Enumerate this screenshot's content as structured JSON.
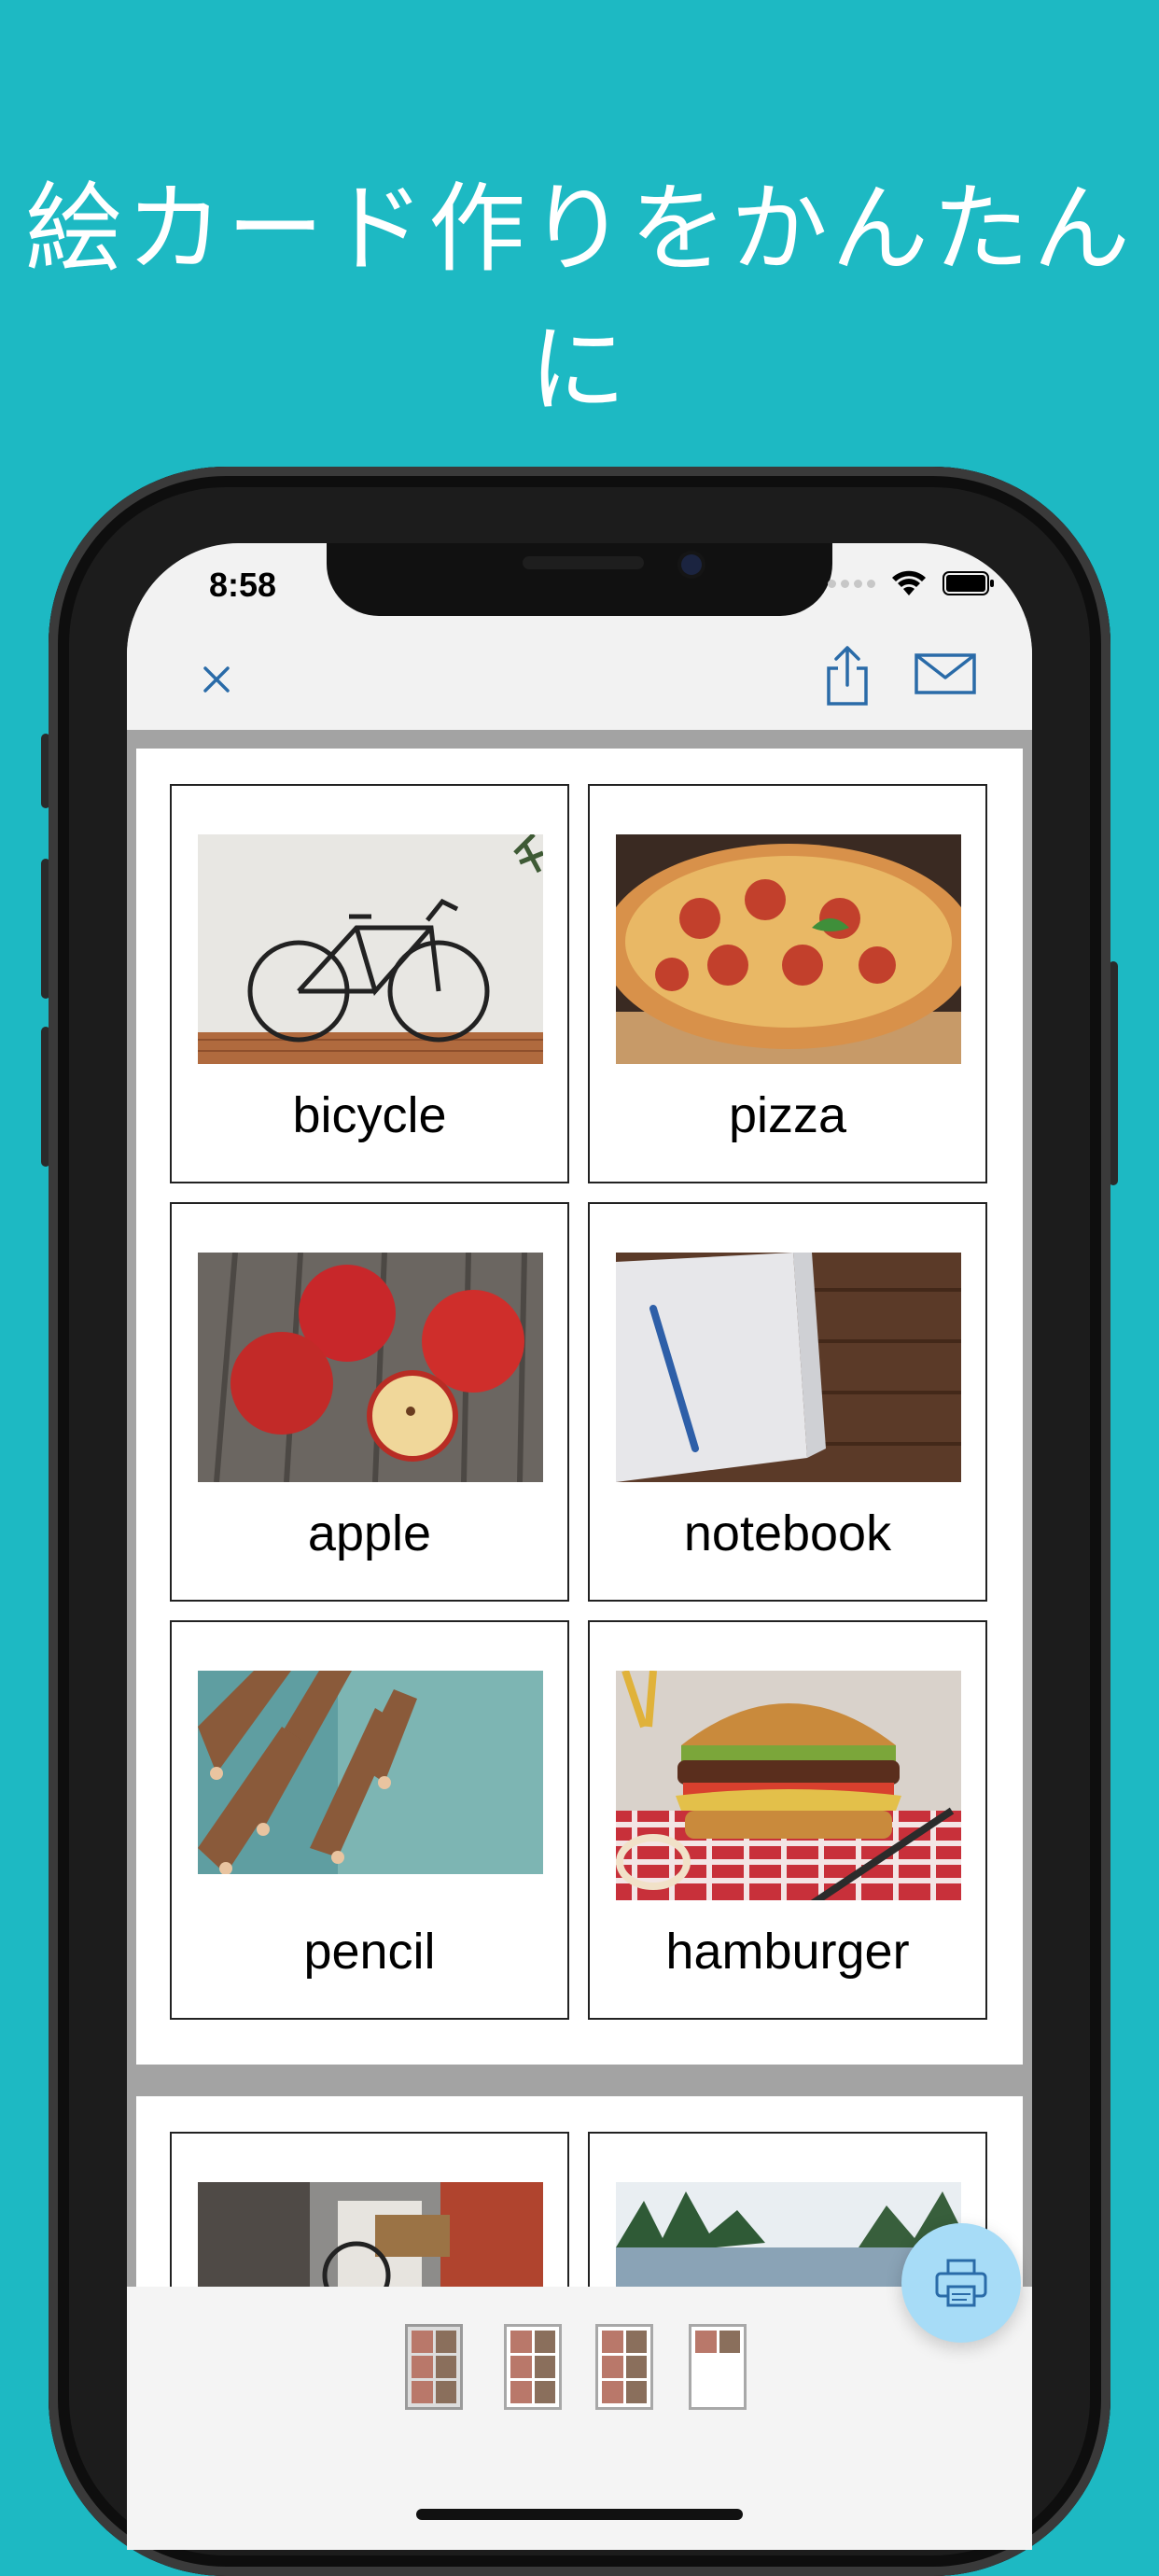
{
  "headline": "絵カード作りをかんたんに",
  "status_bar": {
    "time": "8:58"
  },
  "toolbar": {
    "close_icon": "close-icon",
    "share_icon": "share-icon",
    "mail_icon": "mail-icon"
  },
  "cards": [
    {
      "label": "bicycle",
      "image": "bicycle-photo"
    },
    {
      "label": "pizza",
      "image": "pizza-photo"
    },
    {
      "label": "apple",
      "image": "apple-photo"
    },
    {
      "label": "notebook",
      "image": "notebook-photo"
    },
    {
      "label": "pencil",
      "image": "pencil-photo"
    },
    {
      "label": "hamburger",
      "image": "hamburger-photo"
    }
  ],
  "next_page_cards": [
    {
      "image": "street-bicycle-photo"
    },
    {
      "image": "landscape-photo"
    }
  ],
  "page_thumbnails": [
    {
      "page": 1,
      "selected": true
    },
    {
      "page": 2,
      "selected": false
    },
    {
      "page": 3,
      "selected": false
    },
    {
      "page": 4,
      "selected": false
    }
  ],
  "print_button_icon": "printer-icon",
  "colors": {
    "background": "#1db9c3",
    "accent_icon": "#2a6ba8",
    "print_button": "#a7dcf7"
  }
}
